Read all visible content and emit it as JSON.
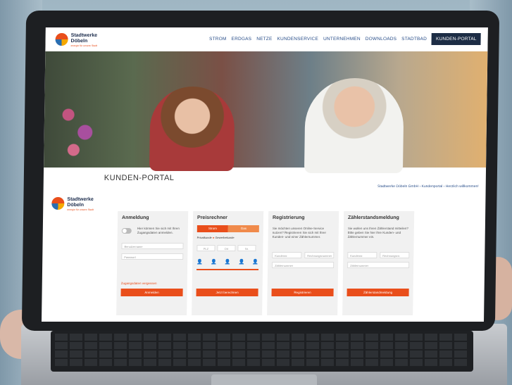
{
  "site": {
    "logo_name": "Stadtwerke Döbeln",
    "logo_tagline": "energie für unsere Stadt",
    "nav": [
      "STROM",
      "ERDGAS",
      "NETZE",
      "KUNDENSERVICE",
      "UNTERNEHMEN",
      "DOWNLOADS",
      "STADTBAD",
      "KUNDEN-PORTAL"
    ],
    "page_title": "KUNDEN-PORTAL",
    "breadcrumb": "Stadtwerke Döbeln GmbH › Kundenportal › Herzlich willkommen!"
  },
  "panels": {
    "login": {
      "title": "Anmeldung",
      "text": "Hier können Sie sich mit Ihren Zugangsdaten anmelden.",
      "username_placeholder": "Benutzername",
      "password_placeholder": "Passwort",
      "forgot_link": "Zugangsdaten vergessen",
      "button": "Anmelden"
    },
    "price": {
      "title": "Preisrechner",
      "tab_power": "Strom",
      "tab_gas": "Gas",
      "private": "Privatkunde",
      "business": "Gewerbekunde",
      "plz": "PLZ",
      "persons_label": "Jährlicher Verbrauch in kWh",
      "field1": "",
      "field2": "Ort",
      "field3": "Nr.",
      "button": "Jetzt berechnen"
    },
    "register": {
      "title": "Registrierung",
      "text": "Sie möchten unseren Online-Service nutzen? Registrieren Sie sich mit Ihrer Kunden- und einer Zählernummer.",
      "customer_placeholder": "Kundennr.",
      "meter_placeholder": "Rechnungsnummer",
      "counter_placeholder": "Zählernummer",
      "button": "Registrieren"
    },
    "meter": {
      "title": "Zählerstandsmeldung",
      "text": "Sie wollen uns Ihren Zählerstand mitteilen? Bitte geben Sie hier Ihre Kunden- und Zählernummer ein.",
      "customer_placeholder": "Kundennr.",
      "invoice_placeholder": "Rechnungsnr.",
      "counter_placeholder": "Zählernummer",
      "button": "Zählerstandmeldung"
    }
  }
}
